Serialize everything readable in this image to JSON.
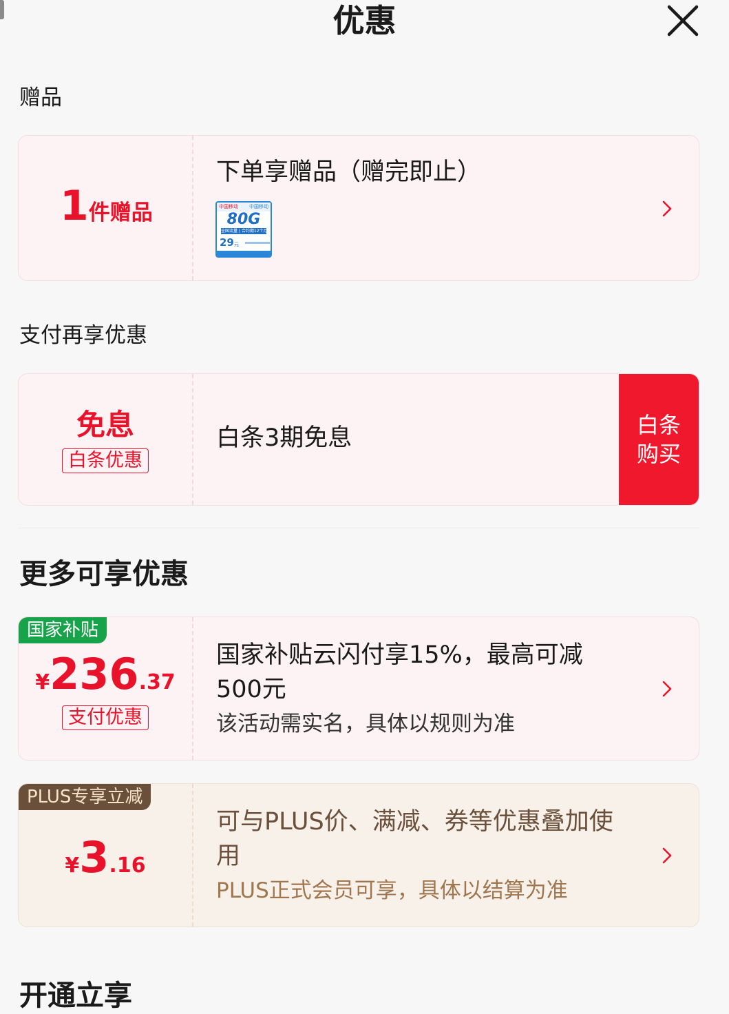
{
  "header": {
    "title": "优惠"
  },
  "gift_section": {
    "heading": "赠品",
    "card": {
      "count": "1",
      "count_unit": "件赠品",
      "title": "下单享赠品（赠完即止）",
      "thumb": {
        "brand_left": "中国移动",
        "brand_right": "中国移动",
        "data": "80G",
        "subtitle": "全国流量 | 合约期12个月",
        "price": "29",
        "price_unit": "元"
      }
    }
  },
  "pay_section": {
    "heading": "支付再享优惠",
    "card": {
      "main": "免息",
      "tag": "白条优惠",
      "desc": "白条3期免息",
      "button_line1": "白条",
      "button_line2": "购买"
    }
  },
  "more_section": {
    "heading": "更多可享优惠",
    "subsidy": {
      "corner": "国家补贴",
      "currency": "¥",
      "integer": "236",
      "decimal": ".37",
      "tag": "支付优惠",
      "title_line1": "国家补贴云闪付享15%，最高可减",
      "title_line2": "500元",
      "note": "该活动需实名，具体以规则为准"
    },
    "plus": {
      "corner": "PLUS专享立减",
      "currency": "¥",
      "integer": "3",
      "decimal": ".16",
      "title_line1": "可与PLUS价、满减、券等优惠叠加使",
      "title_line2": "用",
      "note": "PLUS正式会员可享，具体以结算为准"
    }
  },
  "open_section": {
    "heading": "开通立享"
  },
  "colors": {
    "accent_red": "#e8132a",
    "subsidy_green": "#17a34a",
    "plus_brown": "#6a4f3a",
    "plus_note": "#a0764f"
  }
}
